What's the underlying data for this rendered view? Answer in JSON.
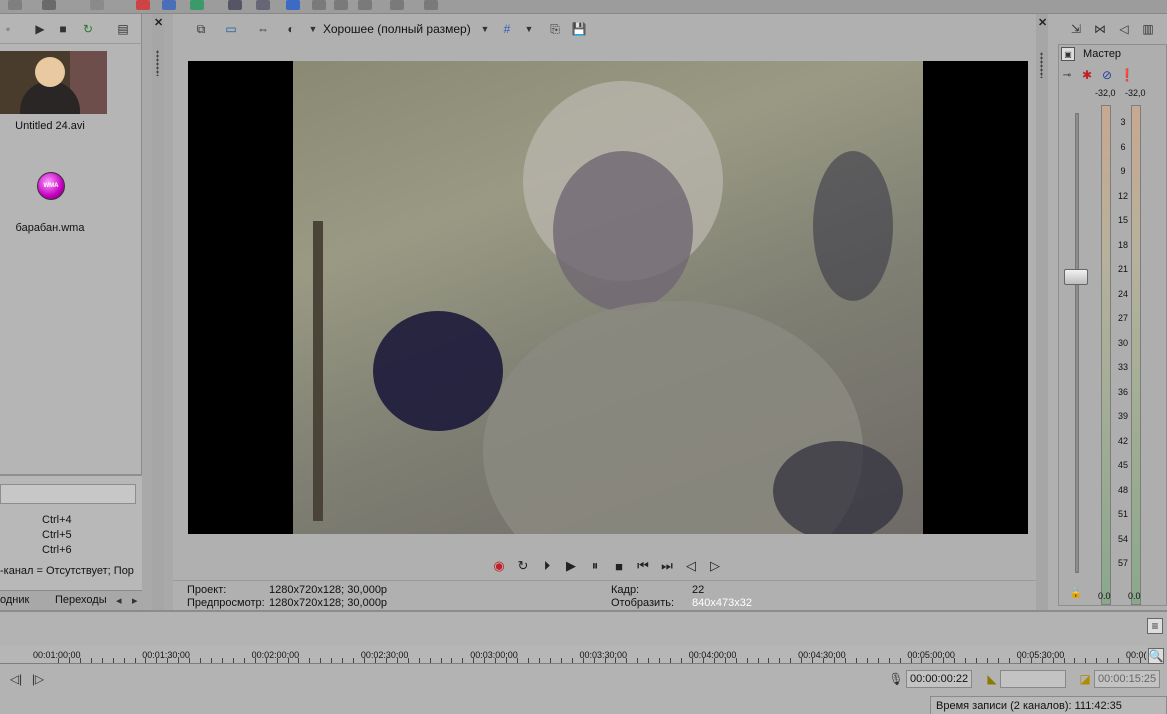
{
  "explorer": {
    "media": [
      {
        "name": "Untitled 24.avi"
      },
      {
        "name": "барабан.wma",
        "icon_text": "WMA"
      }
    ],
    "shortcuts": [
      "Ctrl+4",
      "Ctrl+5",
      "Ctrl+6"
    ],
    "channel_info": "-канал = Отсутствует; Пор",
    "tabs": [
      "одник",
      "Переходы"
    ]
  },
  "preview": {
    "quality": "Хорошее (полный размер)",
    "project_label": "Проект:",
    "project_value": "1280x720x128; 30,000p",
    "preview_label": "Предпросмотр:",
    "preview_value": "1280x720x128; 30,000p",
    "frame_label": "Кадр:",
    "frame_value": "22",
    "display_label": "Отобразить:",
    "display_value": "840x473x32"
  },
  "mixer": {
    "title": "Мастер",
    "peak_left": "-32,0",
    "peak_right": "-32,0",
    "scale": [
      "3",
      "6",
      "9",
      "12",
      "15",
      "18",
      "21",
      "24",
      "27",
      "30",
      "33",
      "36",
      "39",
      "42",
      "45",
      "48",
      "51",
      "54",
      "57"
    ],
    "level_left": "0.0",
    "level_right": "0.0"
  },
  "timeline": {
    "ruler": [
      "00:01:00:00",
      "00:01:30:00",
      "00:02:00:00",
      "00:02:30:00",
      "00:03:00:00",
      "00:03:30:00",
      "00:04:00:00",
      "00:04:30:00",
      "00:05:00:00",
      "00:05:30:00",
      "00:0("
    ],
    "cursor_time": "00:00:00:22",
    "end_time": "00:00:15:25",
    "record_time": "Время записи (2 каналов): 111:42:35"
  },
  "colors": {
    "panel": "#b0b0b0",
    "video_bg": "#000000",
    "record_button": "#c0202a",
    "wma_icon": "#c400c0"
  }
}
